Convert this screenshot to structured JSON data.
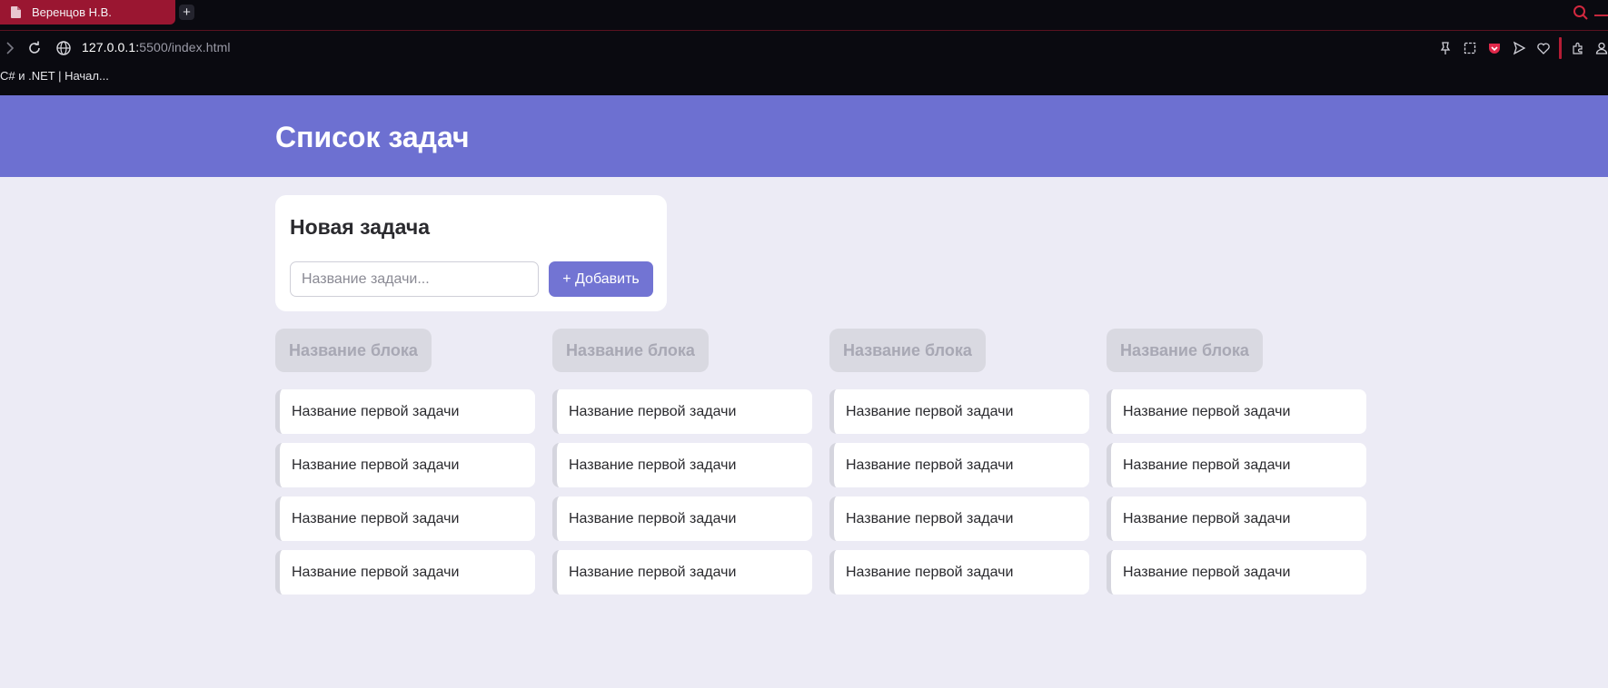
{
  "browser": {
    "tab_title": "Веренцов Н.В.",
    "new_tab_symbol": "+",
    "url_host": "127.0.0.1:",
    "url_rest": "5500/index.html",
    "bookmark": "C# и .NET | Начал..."
  },
  "header": {
    "title": "Список задач"
  },
  "new_task": {
    "title": "Новая задача",
    "input_placeholder": "Название задачи...",
    "input_value": "",
    "add_button": "+ Добавить"
  },
  "columns": [
    {
      "title": "Название блока",
      "tasks": [
        "Название первой задачи",
        "Название первой задачи",
        "Название первой задачи",
        "Название первой задачи"
      ]
    },
    {
      "title": "Название блока",
      "tasks": [
        "Название первой задачи",
        "Название первой задачи",
        "Название первой задачи",
        "Название первой задачи"
      ]
    },
    {
      "title": "Название блока",
      "tasks": [
        "Название первой задачи",
        "Название первой задачи",
        "Название первой задачи",
        "Название первой задачи"
      ]
    },
    {
      "title": "Название блока",
      "tasks": [
        "Название первой задачи",
        "Название первой задачи",
        "Название первой задачи",
        "Название первой задачи"
      ]
    }
  ],
  "colors": {
    "header_bg": "#6d70d1",
    "page_bg": "#ecebf5",
    "button_bg": "#7274d3",
    "tab_bg": "#9a1631"
  },
  "icons": {
    "tab": "document-icon",
    "toolbar": [
      "forward-icon",
      "reload-icon",
      "site-info-icon"
    ],
    "extensions": [
      "pin-icon",
      "snapshot-icon",
      "pocket-icon",
      "send-icon",
      "heart-icon",
      "extensions-icon",
      "profile-icon"
    ],
    "window": [
      "search-icon",
      "minimize-icon"
    ]
  }
}
